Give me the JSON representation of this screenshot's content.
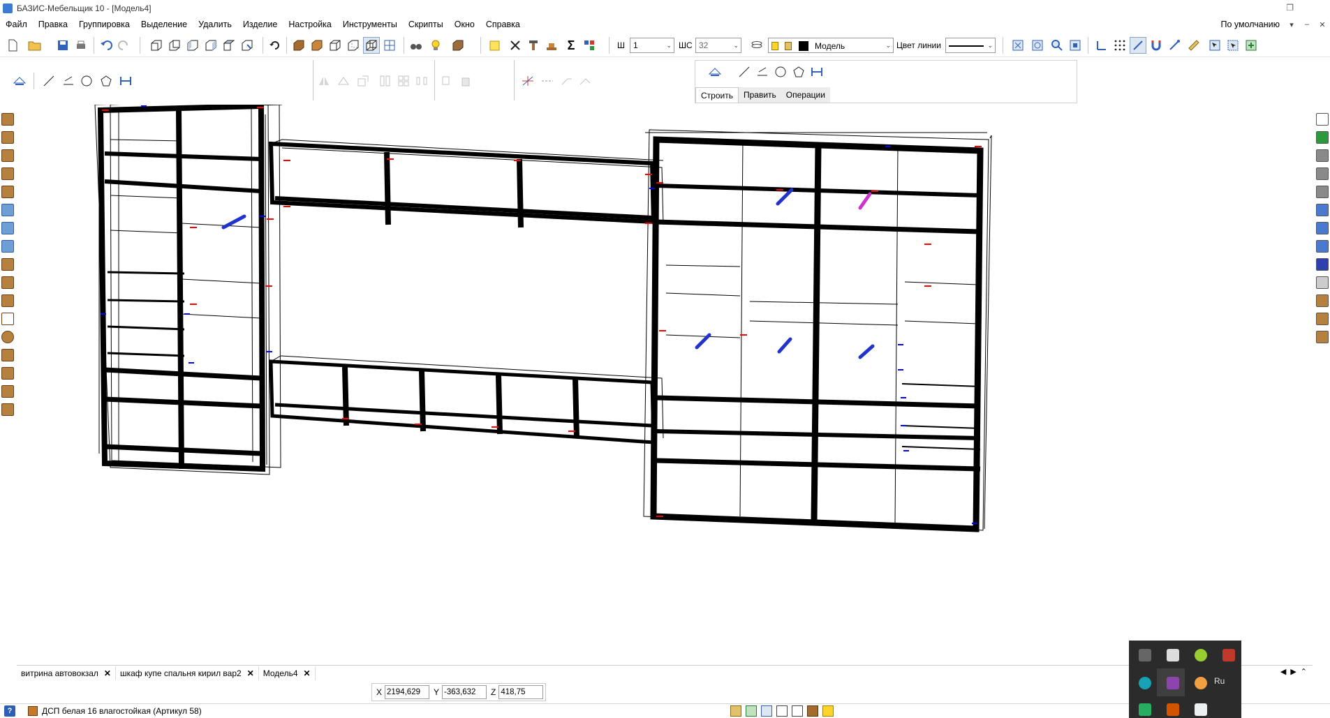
{
  "window": {
    "title": "БАЗИС-Мебельщик 10 - [Модель4]",
    "restore_glyph": "❐"
  },
  "menu": {
    "items": [
      "Файл",
      "Правка",
      "Группировка",
      "Выделение",
      "Удалить",
      "Изделие",
      "Настройка",
      "Инструменты",
      "Скрипты",
      "Окно",
      "Справка"
    ],
    "profile": "По умолчанию",
    "profile_arrow": "▾",
    "minimize_glyph": "–",
    "close_glyph": "✕"
  },
  "toolbar": {
    "width_label": "Ш",
    "width_value": "1",
    "step_label": "ШС",
    "step_value": "32",
    "layer_value": "Модель",
    "line_color_label": "Цвет линии",
    "dropdown_arrow": "⌄"
  },
  "context_panel": {
    "tabs": [
      "Строить",
      "Править",
      "Операции"
    ],
    "active_tab": 0
  },
  "documents": {
    "tabs": [
      "витрина автовокзал",
      "шкаф купе спальня кирил вар2",
      "Модель4"
    ],
    "active": 2,
    "close_glyph": "✕",
    "nav_left": "◀",
    "nav_right": "▶",
    "nav_expand": "⌃"
  },
  "coords": {
    "x_label": "X",
    "x_value": "2194,629",
    "y_label": "Y",
    "y_value": "-363,632",
    "z_label": "Z",
    "z_value": "418,75"
  },
  "status": {
    "help_glyph": "?",
    "material": "ДСП белая 16 влагостойкая (Артикул 58)"
  },
  "tray": {
    "lang": "Ru"
  },
  "colors": {
    "wire": "#000000",
    "joint_red": "#ff0000",
    "joint_blue": "#0000ff",
    "handle_blue": "#2233cc",
    "handle_magenta": "#cc33cc",
    "tray_bg": "#2b2b2b",
    "tool_brown": "#b6803f"
  },
  "icons": {
    "toolbar1": [
      "new-file-icon",
      "open-folder-icon",
      "save-icon",
      "print-icon",
      "undo-icon",
      "redo-icon",
      "view-front-icon",
      "view-back-icon",
      "view-left-icon",
      "view-right-icon",
      "view-top-icon",
      "view-iso-icon",
      "rotate-icon",
      "render-solid-icon",
      "render-shaded-icon",
      "render-wire-icon",
      "render-hidden-icon",
      "render-outline-icon",
      "render-frame-icon",
      "binoculars-icon",
      "bulb-icon",
      "box-icon",
      "sticky-note-icon",
      "scissors-icon",
      "hammer-icon",
      "sum-icon",
      "groups-icon"
    ],
    "toolbar_right": [
      "zoom-all-icon",
      "zoom-window-icon",
      "zoom-icon",
      "zoom-prev-icon",
      "snap-axis-icon",
      "grid-icon",
      "snap-icon",
      "magnet-icon",
      "ortho-icon",
      "measure-icon",
      "select-icon",
      "select-window-icon",
      "layers-icon"
    ]
  }
}
